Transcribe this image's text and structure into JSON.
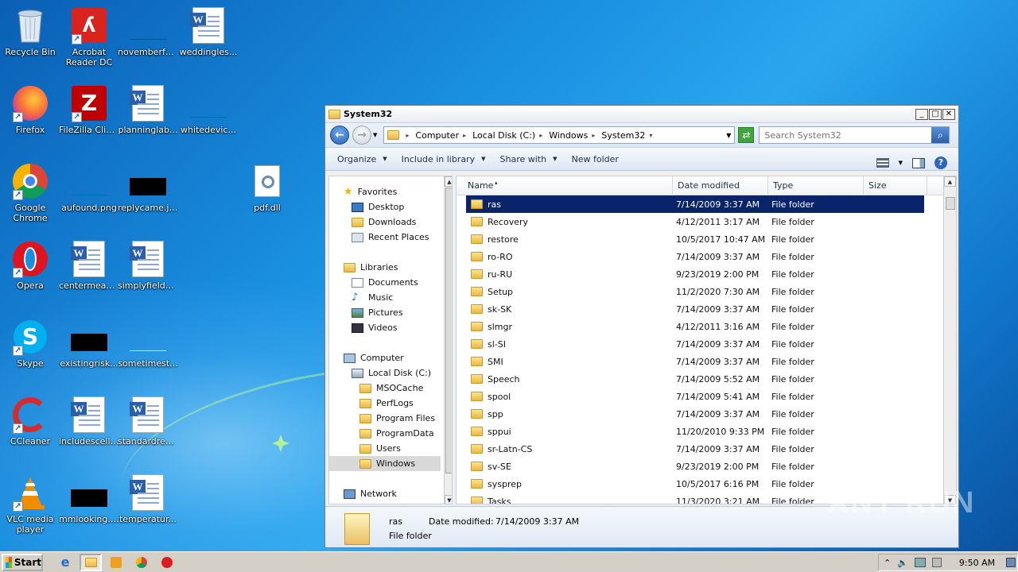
{
  "desktop": {
    "icons": [
      {
        "label": "Recycle Bin"
      },
      {
        "label": "Acrobat Reader DC"
      },
      {
        "label": "novemberfu..."
      },
      {
        "label": "weddingles..."
      },
      {
        "label": "Firefox"
      },
      {
        "label": "FileZilla Client"
      },
      {
        "label": "planninglab..."
      },
      {
        "label": "whitedevic..."
      },
      {
        "label": "Google Chrome"
      },
      {
        "label": "aufound.png"
      },
      {
        "label": "replycame.jpg"
      },
      {
        "label": "pdf.dll"
      },
      {
        "label": "Opera"
      },
      {
        "label": "centermean..."
      },
      {
        "label": "simplyfields.rtf"
      },
      {
        "label": "Skype"
      },
      {
        "label": "existingrisk..."
      },
      {
        "label": "sometimest..."
      },
      {
        "label": "CCleaner"
      },
      {
        "label": "includescell.rtf"
      },
      {
        "label": "standardrep..."
      },
      {
        "label": "VLC media player"
      },
      {
        "label": "mmlooking.jpg"
      },
      {
        "label": "temperatur..."
      }
    ]
  },
  "window": {
    "title": "System32",
    "controls": {
      "minimize": "_",
      "maximize": "□",
      "close": "✕"
    },
    "breadcrumb": [
      "Computer",
      "Local Disk (C:)",
      "Windows",
      "System32"
    ],
    "search_placeholder": "Search System32",
    "commands": {
      "organize": "Organize",
      "include_in_library": "Include in library",
      "share_with": "Share with",
      "new_folder": "New folder"
    },
    "nav": {
      "favorites": "Favorites",
      "desktop": "Desktop",
      "downloads": "Downloads",
      "recent_places": "Recent Places",
      "libraries": "Libraries",
      "documents": "Documents",
      "music": "Music",
      "pictures": "Pictures",
      "videos": "Videos",
      "computer": "Computer",
      "local_disk": "Local Disk (C:)",
      "msocache": "MSOCache",
      "perflogs": "PerfLogs",
      "program_files": "Program Files",
      "programdata": "ProgramData",
      "users": "Users",
      "windows": "Windows",
      "network": "Network"
    },
    "columns": {
      "name": "Name",
      "date_modified": "Date modified",
      "type": "Type",
      "size": "Size"
    },
    "files": [
      {
        "name": "ras",
        "date": "7/14/2009 3:37 AM",
        "type": "File folder"
      },
      {
        "name": "Recovery",
        "date": "4/12/2011 3:17 AM",
        "type": "File folder"
      },
      {
        "name": "restore",
        "date": "10/5/2017 10:47 AM",
        "type": "File folder"
      },
      {
        "name": "ro-RO",
        "date": "7/14/2009 3:37 AM",
        "type": "File folder"
      },
      {
        "name": "ru-RU",
        "date": "9/23/2019 2:00 PM",
        "type": "File folder"
      },
      {
        "name": "Setup",
        "date": "11/2/2020 7:30 AM",
        "type": "File folder"
      },
      {
        "name": "sk-SK",
        "date": "7/14/2009 3:37 AM",
        "type": "File folder"
      },
      {
        "name": "slmgr",
        "date": "4/12/2011 3:16 AM",
        "type": "File folder"
      },
      {
        "name": "sl-SI",
        "date": "7/14/2009 3:37 AM",
        "type": "File folder"
      },
      {
        "name": "SMI",
        "date": "7/14/2009 3:37 AM",
        "type": "File folder"
      },
      {
        "name": "Speech",
        "date": "7/14/2009 5:52 AM",
        "type": "File folder"
      },
      {
        "name": "spool",
        "date": "7/14/2009 5:41 AM",
        "type": "File folder"
      },
      {
        "name": "spp",
        "date": "7/14/2009 3:37 AM",
        "type": "File folder"
      },
      {
        "name": "sppui",
        "date": "11/20/2010 9:33 PM",
        "type": "File folder"
      },
      {
        "name": "sr-Latn-CS",
        "date": "7/14/2009 3:37 AM",
        "type": "File folder"
      },
      {
        "name": "sv-SE",
        "date": "9/23/2019 2:00 PM",
        "type": "File folder"
      },
      {
        "name": "sysprep",
        "date": "10/5/2017 6:16 PM",
        "type": "File folder"
      },
      {
        "name": "Tasks",
        "date": "11/3/2020 3:21 AM",
        "type": "File folder"
      }
    ],
    "details": {
      "name": "ras",
      "date_label": "Date modified:",
      "date_value": "7/14/2009 3:37 AM",
      "type": "File folder"
    }
  },
  "taskbar": {
    "start_label": "Start",
    "clock": "9:50 AM"
  },
  "watermark": "ANY RUN"
}
